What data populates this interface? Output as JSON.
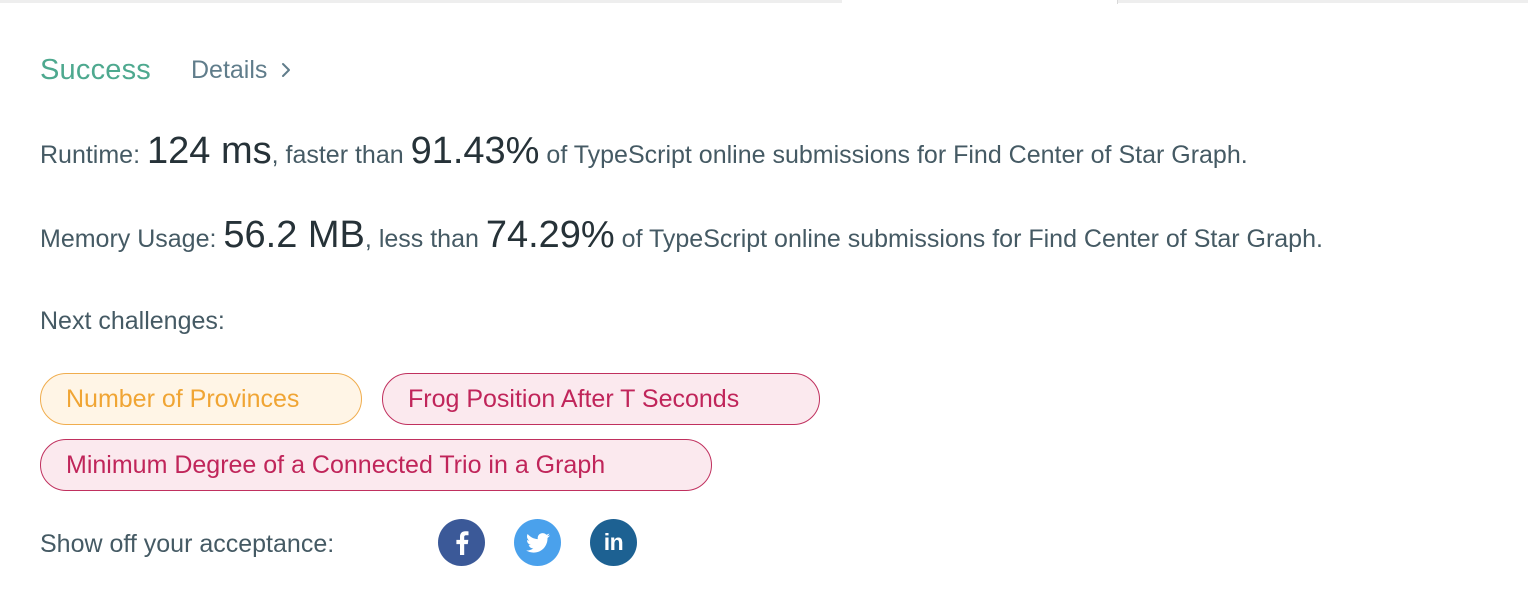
{
  "result": {
    "status": "Success",
    "details_label": "Details",
    "status_color": "#4ea98f"
  },
  "runtime": {
    "label": "Runtime: ",
    "value": "124 ms",
    "comparison": ", faster than ",
    "percent": "91.43%",
    "suffix": " of TypeScript online submissions for Find Center of Star Graph."
  },
  "memory": {
    "label": "Memory Usage: ",
    "value": "56.2 MB",
    "comparison": ", less than ",
    "percent": "74.29%",
    "suffix": " of TypeScript online submissions for Find Center of Star Graph."
  },
  "next_challenges": {
    "label": "Next challenges:",
    "items": [
      {
        "title": "Number of Provinces",
        "difficulty": "medium",
        "color": "#f0a534"
      },
      {
        "title": "Frog Position After T Seconds",
        "difficulty": "hard",
        "color": "#c0255a"
      },
      {
        "title": "Minimum Degree of a Connected Trio in a Graph",
        "difficulty": "hard",
        "color": "#c0255a"
      }
    ]
  },
  "share": {
    "label": "Show off your acceptance:",
    "icons": [
      {
        "name": "facebook-icon",
        "color": "#3b5998"
      },
      {
        "name": "twitter-icon",
        "color": "#4aa1ec"
      },
      {
        "name": "linkedin-icon",
        "color": "#1d6192",
        "glyph": "in"
      }
    ]
  }
}
